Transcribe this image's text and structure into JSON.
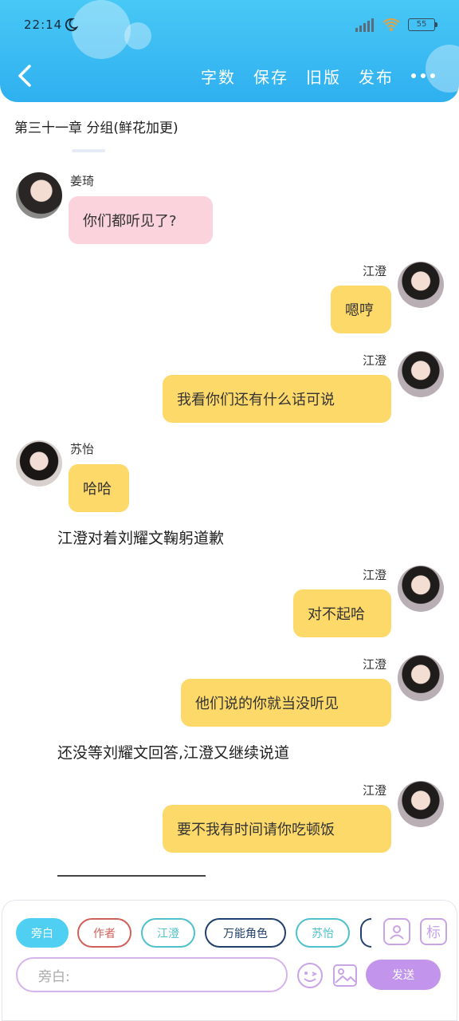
{
  "status_bar": {
    "time": "22:14",
    "network": "HD",
    "battery": "55"
  },
  "toolbar": {
    "word_count": "字数",
    "save": "保存",
    "old_version": "旧版",
    "publish": "发布"
  },
  "chapter": {
    "title": "第三十一章 分组(鲜花加更)"
  },
  "messages": [
    {
      "sender": "姜琦",
      "text": "你们都听见了?",
      "side": "left",
      "color": "pink"
    },
    {
      "sender": "江澄",
      "text": "嗯哼",
      "side": "right",
      "color": "yellow"
    },
    {
      "sender": "江澄",
      "text": "我看你们还有什么话可说",
      "side": "right",
      "color": "yellow"
    },
    {
      "sender": "苏怡",
      "text": "哈哈",
      "side": "left",
      "color": "yellow"
    },
    {
      "narration": "江澄对着刘耀文鞠躬道歉"
    },
    {
      "sender": "江澄",
      "text": "对不起哈",
      "side": "right",
      "color": "yellow"
    },
    {
      "sender": "江澄",
      "text": "他们说的你就当没听见",
      "side": "right",
      "color": "yellow"
    },
    {
      "narration": "还没等刘耀文回答,江澄又继续说道"
    },
    {
      "sender": "江澄",
      "text": "要不我有时间请你吃顿饭",
      "side": "right",
      "color": "yellow"
    }
  ],
  "divider": "——————————",
  "roles": [
    {
      "label": "旁白",
      "color": "#4fd0f2",
      "active": true
    },
    {
      "label": "作者",
      "color": "#d0605a"
    },
    {
      "label": "江澄",
      "color": "#4ec1cc"
    },
    {
      "label": "万能角色",
      "color": "#20406e"
    },
    {
      "label": "苏怡",
      "color": "#4ec1cc"
    }
  ],
  "right_icons": {
    "role_icon": "person-card-icon",
    "tag_label": "标"
  },
  "composer": {
    "placeholder": "旁白:",
    "send_label": "发送"
  },
  "colors": {
    "header": "#2fb0f0",
    "bubble_yellow": "#fdd96a",
    "bubble_pink": "#fbd3dd",
    "send": "#c294ec"
  }
}
